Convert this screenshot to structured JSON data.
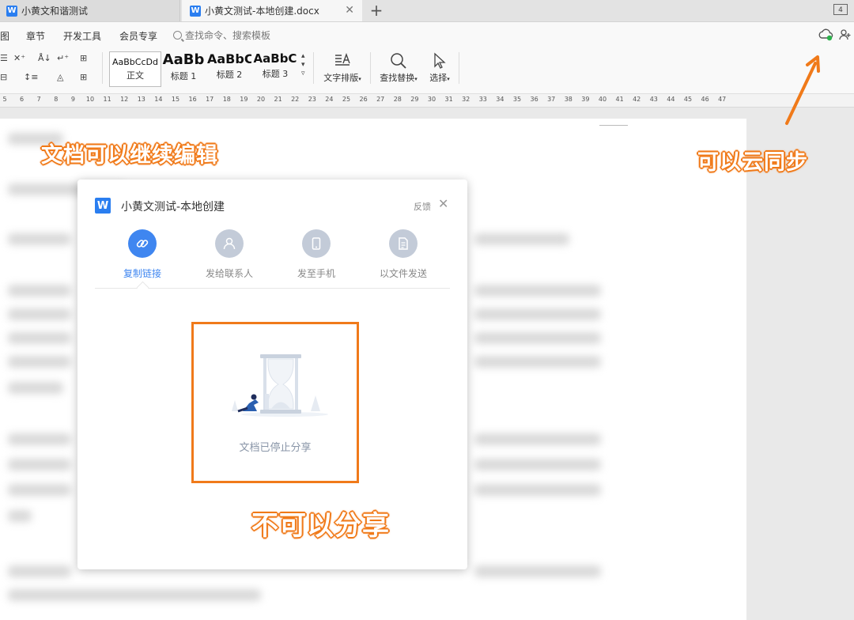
{
  "tabs": [
    {
      "label": "小黄文和谐测试"
    },
    {
      "label": "小黄文测试-本地创建.docx"
    }
  ],
  "tab_add": "+",
  "window_badge": "4",
  "menu": {
    "items": [
      "图",
      "章节",
      "开发工具",
      "会员专享"
    ],
    "search_placeholder": "查找命令、搜索模板"
  },
  "ribbon": {
    "styles": [
      {
        "sample": "AaBbCcDd",
        "label": "正文"
      },
      {
        "sample": "AaBb",
        "label": "标题 1"
      },
      {
        "sample": "AaBbC",
        "label": "标题 2"
      },
      {
        "sample": "AaBbC",
        "label": "标题 3"
      }
    ],
    "tools": [
      {
        "label": "文字排版"
      },
      {
        "label": "查找替换"
      },
      {
        "label": "选择"
      }
    ]
  },
  "ruler_numbers": [
    "5",
    "6",
    "7",
    "8",
    "9",
    "10",
    "11",
    "12",
    "13",
    "14",
    "15",
    "16",
    "17",
    "18",
    "19",
    "20",
    "21",
    "22",
    "23",
    "24",
    "25",
    "26",
    "27",
    "28",
    "29",
    "30",
    "31",
    "32",
    "33",
    "34",
    "35",
    "36",
    "37",
    "38",
    "39",
    "40",
    "41",
    "42",
    "43",
    "44",
    "45",
    "46",
    "47"
  ],
  "annotations": {
    "edit": "文档可以继续编辑",
    "cloud": "可以云同步",
    "share": "不可以分享"
  },
  "dialog": {
    "title": "小黄文测试-本地创建",
    "feedback": "反馈",
    "options": [
      {
        "label": "复制链接",
        "icon": "link-icon",
        "active": true
      },
      {
        "label": "发给联系人",
        "icon": "contact-icon",
        "active": false
      },
      {
        "label": "发至手机",
        "icon": "phone-icon",
        "active": false
      },
      {
        "label": "以文件发送",
        "icon": "file-icon",
        "active": false
      }
    ],
    "stopped_message": "文档已停止分享"
  },
  "colors": {
    "accent_blue": "#3f86f0",
    "annotation_orange": "#f07a1a"
  }
}
